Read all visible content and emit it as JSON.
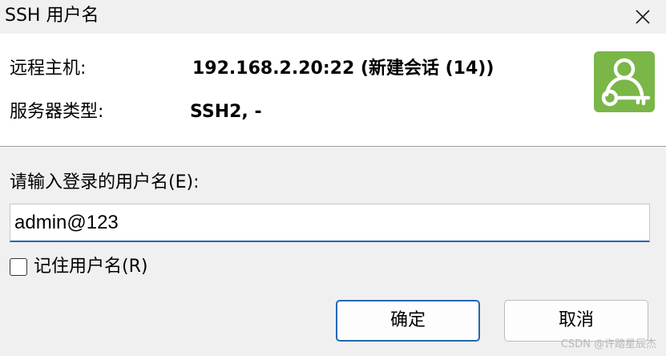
{
  "window": {
    "title": "SSH 用户名",
    "close_icon": "close-icon"
  },
  "info": {
    "host_label": "远程主机:",
    "host_value": "192.168.2.20:22 (新建会话 (14))",
    "server_type_label": "服务器类型:",
    "server_type_value": "SSH2, -",
    "badge_icon": "user-key-icon",
    "badge_color": "#7ab648"
  },
  "form": {
    "prompt_label": "请输入登录的用户名(E):",
    "username_value": "admin@123",
    "remember_label": "记住用户名(R)",
    "remember_checked": false
  },
  "buttons": {
    "ok_label": "确定",
    "cancel_label": "取消"
  },
  "watermark": "CSDN @许踏星辰杰",
  "colors": {
    "accent": "#2566b5"
  }
}
